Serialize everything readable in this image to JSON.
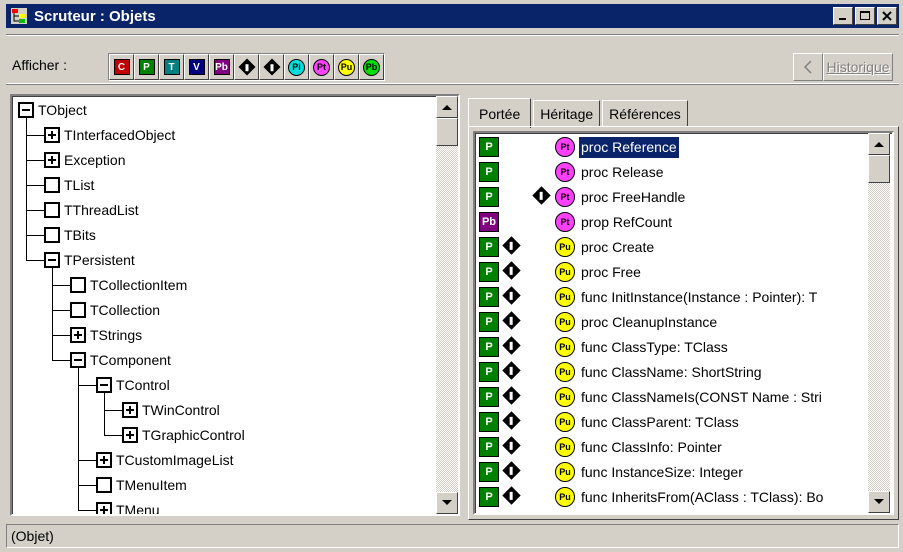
{
  "window": {
    "title": "Scruteur : Objets",
    "buttons": [
      "_",
      "□",
      "×"
    ]
  },
  "toolbar": {
    "show_label": "Afficher :",
    "filters": [
      {
        "id": "C",
        "kind": "square",
        "color": "#c00000",
        "label": "C"
      },
      {
        "id": "P",
        "kind": "square",
        "color": "#008000",
        "label": "P"
      },
      {
        "id": "T",
        "kind": "square",
        "color": "#008080",
        "label": "T"
      },
      {
        "id": "V",
        "kind": "square",
        "color": "#000080",
        "label": "V"
      },
      {
        "id": "Pb",
        "kind": "square",
        "color": "#800080",
        "label": "Pb"
      },
      {
        "id": "virtual",
        "kind": "diamond",
        "label": ""
      },
      {
        "id": "override",
        "kind": "diamond",
        "label": ""
      },
      {
        "id": "Pi",
        "kind": "circle",
        "color": "#00e0e0",
        "label": "Pi"
      },
      {
        "id": "Pt",
        "kind": "circle",
        "color": "#ff40ff",
        "label": "Pt"
      },
      {
        "id": "Pu",
        "kind": "circle",
        "color": "#ffff00",
        "label": "Pu"
      },
      {
        "id": "Pb2",
        "kind": "circle",
        "color": "#00e000",
        "label": "Pb"
      }
    ],
    "back_icon": "back-arrow-icon",
    "history_label": "Historique"
  },
  "tree": {
    "nodes": [
      {
        "label": "TObject",
        "level": 0,
        "state": "expanded"
      },
      {
        "label": "TInterfacedObject",
        "level": 1,
        "state": "collapsed"
      },
      {
        "label": "Exception",
        "level": 1,
        "state": "collapsed"
      },
      {
        "label": "TList",
        "level": 1,
        "state": "leaf"
      },
      {
        "label": "TThreadList",
        "level": 1,
        "state": "leaf"
      },
      {
        "label": "TBits",
        "level": 1,
        "state": "leaf"
      },
      {
        "label": "TPersistent",
        "level": 1,
        "state": "expanded"
      },
      {
        "label": "TCollectionItem",
        "level": 2,
        "state": "leaf"
      },
      {
        "label": "TCollection",
        "level": 2,
        "state": "leaf"
      },
      {
        "label": "TStrings",
        "level": 2,
        "state": "collapsed"
      },
      {
        "label": "TComponent",
        "level": 2,
        "state": "expanded"
      },
      {
        "label": "TControl",
        "level": 3,
        "state": "expanded"
      },
      {
        "label": "TWinControl",
        "level": 4,
        "state": "collapsed"
      },
      {
        "label": "TGraphicControl",
        "level": 4,
        "state": "collapsed"
      },
      {
        "label": "TCustomImageList",
        "level": 3,
        "state": "collapsed"
      },
      {
        "label": "TMenuItem",
        "level": 3,
        "state": "leaf"
      },
      {
        "label": "TMenu",
        "level": 3,
        "state": "collapsed"
      }
    ]
  },
  "tabs": [
    "Portée",
    "Héritage",
    "Références"
  ],
  "members": [
    {
      "scope": "P",
      "scope_color": "#008000",
      "virtual": false,
      "vis": "Pt",
      "vis_color": "#ff40ff",
      "text": "proc Reference",
      "selected": true
    },
    {
      "scope": "P",
      "scope_color": "#008000",
      "virtual": false,
      "vis": "Pt",
      "vis_color": "#ff40ff",
      "text": "proc Release"
    },
    {
      "scope": "P",
      "scope_color": "#008000",
      "virtual": false,
      "override": true,
      "vis": "Pt",
      "vis_color": "#ff40ff",
      "text": "proc FreeHandle"
    },
    {
      "scope": "Pb",
      "scope_color": "#800080",
      "virtual": false,
      "vis": "Pt",
      "vis_color": "#ff40ff",
      "text": "prop RefCount"
    },
    {
      "scope": "P",
      "scope_color": "#008000",
      "virtual": true,
      "vis": "Pu",
      "vis_color": "#ffff00",
      "text": "proc Create"
    },
    {
      "scope": "P",
      "scope_color": "#008000",
      "virtual": true,
      "vis": "Pu",
      "vis_color": "#ffff00",
      "text": "proc Free"
    },
    {
      "scope": "P",
      "scope_color": "#008000",
      "virtual": true,
      "vis": "Pu",
      "vis_color": "#ffff00",
      "text": "func InitInstance(Instance : Pointer): T"
    },
    {
      "scope": "P",
      "scope_color": "#008000",
      "virtual": true,
      "vis": "Pu",
      "vis_color": "#ffff00",
      "text": "proc CleanupInstance"
    },
    {
      "scope": "P",
      "scope_color": "#008000",
      "virtual": true,
      "vis": "Pu",
      "vis_color": "#ffff00",
      "text": "func ClassType: TClass"
    },
    {
      "scope": "P",
      "scope_color": "#008000",
      "virtual": true,
      "vis": "Pu",
      "vis_color": "#ffff00",
      "text": "func ClassName: ShortString"
    },
    {
      "scope": "P",
      "scope_color": "#008000",
      "virtual": true,
      "vis": "Pu",
      "vis_color": "#ffff00",
      "text": "func ClassNameIs(CONST Name : Stri"
    },
    {
      "scope": "P",
      "scope_color": "#008000",
      "virtual": true,
      "vis": "Pu",
      "vis_color": "#ffff00",
      "text": "func ClassParent: TClass"
    },
    {
      "scope": "P",
      "scope_color": "#008000",
      "virtual": true,
      "vis": "Pu",
      "vis_color": "#ffff00",
      "text": "func ClassInfo: Pointer"
    },
    {
      "scope": "P",
      "scope_color": "#008000",
      "virtual": true,
      "vis": "Pu",
      "vis_color": "#ffff00",
      "text": "func InstanceSize: Integer"
    },
    {
      "scope": "P",
      "scope_color": "#008000",
      "virtual": true,
      "vis": "Pu",
      "vis_color": "#ffff00",
      "text": "func InheritsFrom(AClass : TClass): Bo"
    }
  ],
  "status": {
    "text": "(Objet)"
  }
}
